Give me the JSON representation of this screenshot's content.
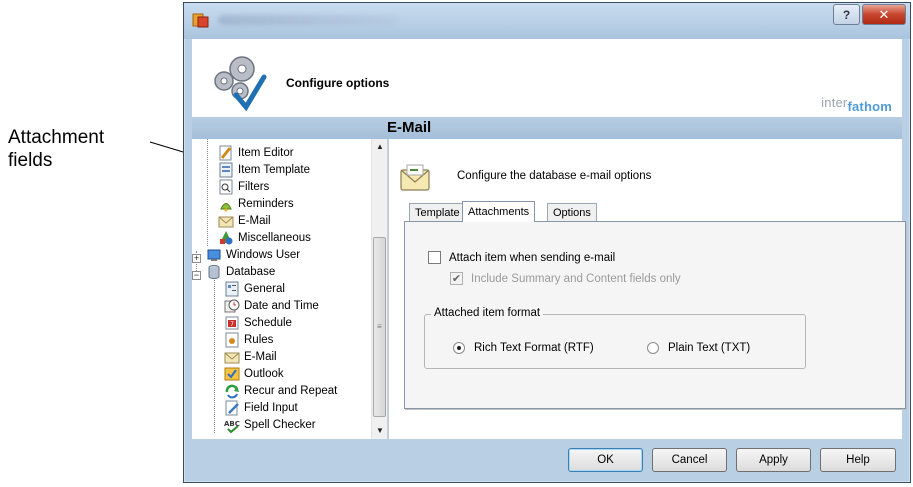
{
  "annotation": {
    "callout_text": "Attachment\nfields"
  },
  "window": {
    "help_glyph": "?",
    "close_glyph": "✕"
  },
  "header": {
    "title": "Configure options",
    "brand_prefix": "inter",
    "brand_suffix": "fathom"
  },
  "section": {
    "title": "E-Mail"
  },
  "tree": {
    "items": [
      {
        "label": "Item Editor",
        "icon": "item-editor-icon"
      },
      {
        "label": "Item Template",
        "icon": "item-template-icon"
      },
      {
        "label": "Filters",
        "icon": "filter-icon"
      },
      {
        "label": "Reminders",
        "icon": "reminder-icon"
      },
      {
        "label": "E-Mail",
        "icon": "email-icon"
      },
      {
        "label": "Miscellaneous",
        "icon": "misc-icon"
      },
      {
        "label": "Windows User",
        "icon": "windows-user-icon",
        "expander": "+"
      },
      {
        "label": "Database",
        "icon": "database-icon",
        "expander": "−"
      },
      {
        "label": "General",
        "icon": "general-icon"
      },
      {
        "label": "Date and Time",
        "icon": "clock-icon"
      },
      {
        "label": "Schedule",
        "icon": "schedule-icon"
      },
      {
        "label": "Rules",
        "icon": "rules-icon"
      },
      {
        "label": "E-Mail",
        "icon": "email-icon"
      },
      {
        "label": "Outlook",
        "icon": "outlook-icon"
      },
      {
        "label": "Recur and Repeat",
        "icon": "recur-icon"
      },
      {
        "label": "Field Input",
        "icon": "field-input-icon"
      },
      {
        "label": "Spell Checker",
        "icon": "spell-checker-icon"
      }
    ]
  },
  "content": {
    "description": "Configure the database e-mail options",
    "tabs": [
      {
        "label": "Template",
        "active": false
      },
      {
        "label": "Attachments",
        "active": true
      },
      {
        "label": "Options",
        "active": false
      }
    ],
    "attach_checkbox": {
      "label": "Attach item when sending e-mail",
      "checked": false
    },
    "include_checkbox": {
      "label": "Include Summary and Content fields only",
      "checked": true,
      "disabled": true
    },
    "format_group": {
      "legend": "Attached item format",
      "options": [
        {
          "label": "Rich Text Format (RTF)",
          "selected": true
        },
        {
          "label": "Plain Text (TXT)",
          "selected": false
        }
      ]
    }
  },
  "footer": {
    "ok": "OK",
    "cancel": "Cancel",
    "apply": "Apply",
    "help": "Help"
  },
  "colors": {
    "section_bar": "#a4bfd9",
    "brand_blue": "#4f9bd2",
    "close_red": "#c8452e"
  }
}
